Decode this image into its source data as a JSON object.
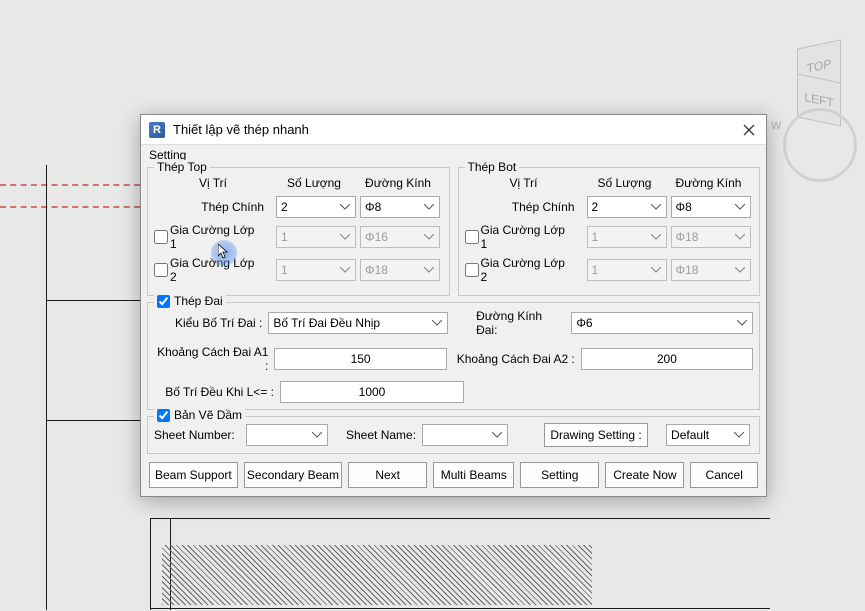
{
  "dialog": {
    "title": "Thiết lập vẽ thép nhanh",
    "menu_setting": "Setting"
  },
  "thep_top": {
    "legend": "Thép Top",
    "col_pos": "Vị Trí",
    "col_qty": "Số Lượng",
    "col_dia": "Đường Kính",
    "main_label": "Thép Chính",
    "main_qty": "2",
    "main_dia": "Φ8",
    "layer1_label": "Gia Cường Lớp 1",
    "layer1_qty": "1",
    "layer1_dia": "Φ16",
    "layer2_label": "Gia Cường Lớp 2",
    "layer2_qty": "1",
    "layer2_dia": "Φ18"
  },
  "thep_bot": {
    "legend": "Thép Bot",
    "col_pos": "Vị Trí",
    "col_qty": "Số Lượng",
    "col_dia": "Đường Kính",
    "main_label": "Thép Chính",
    "main_qty": "2",
    "main_dia": "Φ8",
    "layer1_label": "Gia Cường Lớp 1",
    "layer1_qty": "1",
    "layer1_dia": "Φ18",
    "layer2_label": "Gia Cường Lớp 2",
    "layer2_qty": "1",
    "layer2_dia": "Φ18"
  },
  "thep_dai": {
    "legend": "Thép Đai",
    "kieu_label": "Kiểu Bố Trí Đai :",
    "kieu_value": "Bố Trí Đai Đều Nhịp",
    "dk_label": "Đường Kính Đai:",
    "dk_value": "Φ6",
    "a1_label": "Khoảng Cách Đai A1 :",
    "a1_value": "150",
    "a2_label": "Khoảng Cách Đai A2 :",
    "a2_value": "200",
    "l_label": "Bố Trí Đều Khi L<= :",
    "l_value": "1000"
  },
  "sheet": {
    "legend": "Bản Vẽ Dầm",
    "number_label": "Sheet Number:",
    "number_value": "",
    "name_label": "Sheet Name:",
    "name_value": "",
    "drawing_setting": "Drawing Setting :",
    "default_value": "Default"
  },
  "buttons": {
    "beam_support": "Beam Support",
    "secondary_beam": "Secondary Beam",
    "next": "Next",
    "multi_beams": "Multi Beams",
    "setting": "Setting",
    "create_now": "Create Now",
    "cancel": "Cancel"
  },
  "viewcube": {
    "top": "TOP",
    "left": "LEFT",
    "w": "W"
  }
}
